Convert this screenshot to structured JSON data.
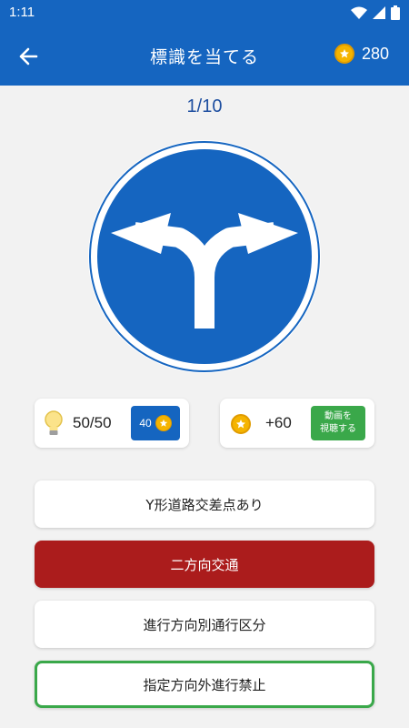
{
  "status_bar": {
    "time": "1:11"
  },
  "app_bar": {
    "title": "標識を当てる",
    "coins": "280"
  },
  "progress": "1/10",
  "hint_card": {
    "count": "50/50",
    "cost": "40"
  },
  "reward_card": {
    "amount": "+60",
    "video_label": "動画を\n視聴する"
  },
  "answers": [
    {
      "label": "Y形道路交差点あり",
      "state": "normal"
    },
    {
      "label": "二方向交通",
      "state": "wrong"
    },
    {
      "label": "進行方向別通行区分",
      "state": "normal"
    },
    {
      "label": "指定方向外進行禁止",
      "state": "correct"
    }
  ],
  "colors": {
    "primary": "#1565c0",
    "wrong": "#ab1c1c",
    "correct": "#3aa84a",
    "coin": "#f5b400",
    "background": "#f2f2f2"
  },
  "icons": {
    "back": "arrow-left-icon",
    "coin": "coin-star-icon",
    "hint": "lightbulb-icon",
    "sign": "split-arrow-traffic-sign"
  }
}
